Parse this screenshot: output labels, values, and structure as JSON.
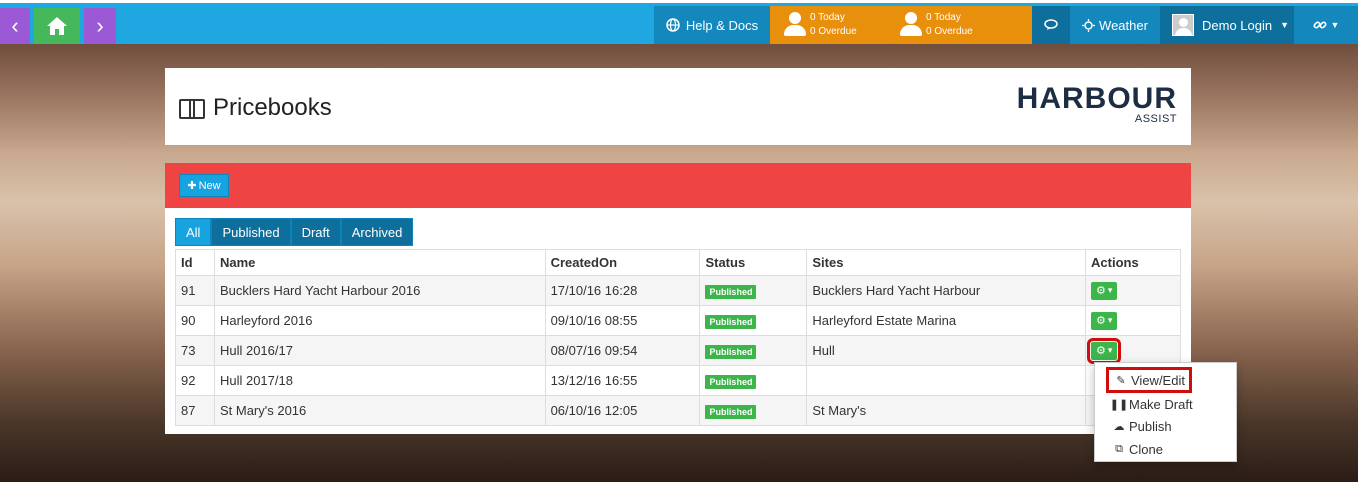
{
  "nav": {
    "back_icon": "chevron-left-icon",
    "home_icon": "home-icon",
    "forward_icon": "chevron-right-icon"
  },
  "topbar": {
    "help_label": "Help & Docs",
    "alerts": [
      {
        "today": "0 Today",
        "overdue": "0 Overdue"
      },
      {
        "today": "0 Today",
        "overdue": "0 Overdue"
      }
    ],
    "weather_label": "Weather",
    "user_label": "Demo Login",
    "colors": {
      "bar": "#1ea7e0",
      "alerts": "#e88f0c",
      "dark": "#0f6f9c"
    }
  },
  "header": {
    "title": "Pricebooks",
    "logo_main": "HARBOUR",
    "logo_sub": "ASSIST"
  },
  "toolbar": {
    "new_label": "New",
    "accent": "#ef4444"
  },
  "tabs": [
    "All",
    "Published",
    "Draft",
    "Archived"
  ],
  "active_tab": "Published",
  "table": {
    "columns": [
      "Id",
      "Name",
      "CreatedOn",
      "Status",
      "Sites",
      "Actions"
    ],
    "rows": [
      {
        "id": "91",
        "name": "Bucklers Hard Yacht Harbour 2016",
        "created": "17/10/16 16:28",
        "status": "Published",
        "sites": "Bucklers Hard Yacht Harbour"
      },
      {
        "id": "90",
        "name": "Harleyford 2016",
        "created": "09/10/16 08:55",
        "status": "Published",
        "sites": "Harleyford Estate Marina"
      },
      {
        "id": "73",
        "name": "Hull 2016/17",
        "created": "08/07/16 09:54",
        "status": "Published",
        "sites": "Hull"
      },
      {
        "id": "92",
        "name": "Hull 2017/18",
        "created": "13/12/16 16:55",
        "status": "Published",
        "sites": ""
      },
      {
        "id": "87",
        "name": "St Mary's 2016",
        "created": "06/10/16 12:05",
        "status": "Published",
        "sites": "St Mary's"
      }
    ]
  },
  "actions_menu": {
    "items": [
      "View/Edit",
      "Make Draft",
      "Publish",
      "Clone"
    ]
  }
}
